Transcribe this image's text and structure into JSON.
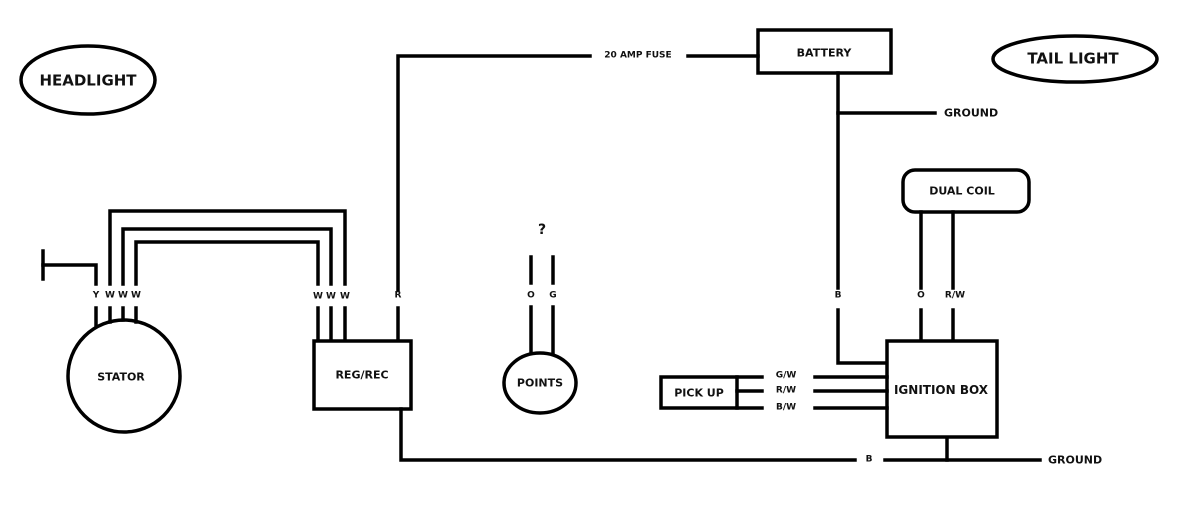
{
  "diagram": {
    "type": "motorcycle-wiring-diagram",
    "components": {
      "headlight": "HEADLIGHT",
      "tail_light": "TAIL LIGHT",
      "battery": "BATTERY",
      "fuse": "20 AMP FUSE",
      "stator": "STATOR",
      "reg_rec": "REG/REC",
      "points": "POINTS",
      "points_unknown": "?",
      "dual_coil": "DUAL COIL",
      "ignition_box": "IGNITION BOX",
      "pick_up": "PICK UP"
    },
    "grounds": {
      "battery_ground": "GROUND",
      "frame_ground": "GROUND"
    },
    "wire_labels": {
      "stator": [
        "Y",
        "W",
        "W",
        "W"
      ],
      "reg_rec_inputs": [
        "W",
        "W",
        "W"
      ],
      "reg_rec_output": "R",
      "points": [
        "O",
        "G"
      ],
      "battery_to_ignition": "B",
      "coil_to_ignition": [
        "O",
        "R/W"
      ],
      "pickup": [
        "G/W",
        "R/W",
        "B/W"
      ],
      "ground_bus": "B"
    }
  }
}
